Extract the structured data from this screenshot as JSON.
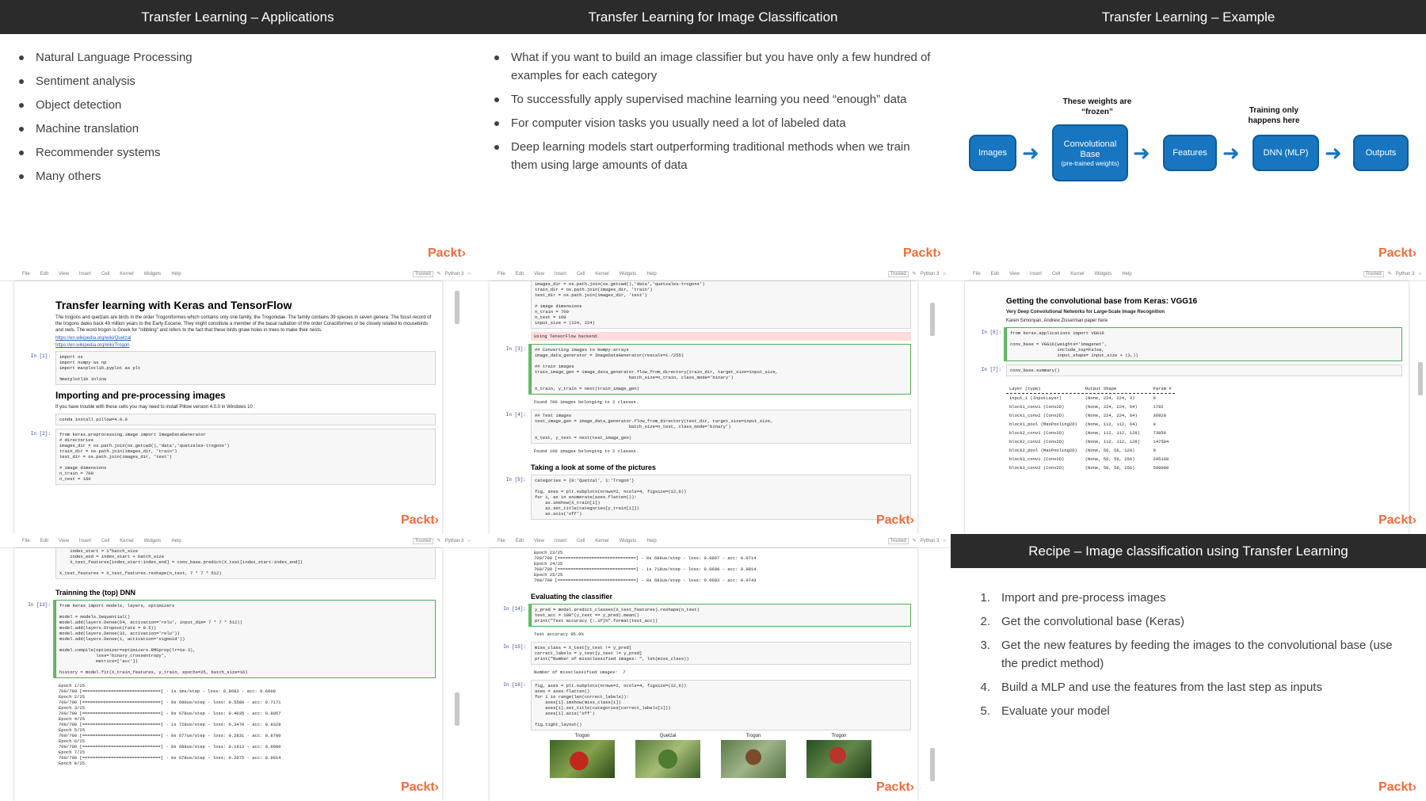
{
  "slides": {
    "applications": {
      "title": "Transfer Learning – Applications",
      "items": [
        "Natural Language Processing",
        "Sentiment analysis",
        "Object detection",
        "Machine translation",
        "Recommender systems",
        "Many others"
      ]
    },
    "image_classification": {
      "title": "Transfer Learning for Image Classification",
      "items": [
        "What if you want to build an image classifier but you have only a few hundred of examples for each category",
        "To successfully apply supervised machine learning you need “enough” data",
        "For computer vision tasks you usually need a lot of labeled data",
        "Deep learning models start outperforming traditional methods when we train them using large amounts of data"
      ]
    },
    "example": {
      "title": "Transfer Learning – Example",
      "note_frozen": "These weights are “frozen”",
      "note_training": "Training only happens here",
      "boxes": {
        "images": "Images",
        "conv": "Convolutional Base",
        "conv_sub": "(pre-trained weights)",
        "features": "Features",
        "dnn": "DNN (MLP)",
        "outputs": "Outputs"
      }
    },
    "recipe": {
      "title": "Recipe – Image classification using Transfer Learning",
      "steps": [
        {
          "num": "1.",
          "text": "Import and pre-process images"
        },
        {
          "num": "2.",
          "text": "Get the convolutional base (Keras)"
        },
        {
          "num": "3.",
          "text": "Get the new features by feeding the images to the convolutional base (use the predict method)"
        },
        {
          "num": "4.",
          "text": "Build a MLP and use the features from the last step as inputs"
        },
        {
          "num": "5.",
          "text": "Evaluate your model"
        }
      ]
    }
  },
  "brand": "Packt›",
  "notebook_menu": {
    "items": [
      "File",
      "Edit",
      "View",
      "Insert",
      "Cell",
      "Kernel",
      "Widgets",
      "Help"
    ],
    "trusted": "Trusted",
    "kernel": "Python 3"
  },
  "nb1": {
    "title": "Transfer learning with Keras and TensorFlow",
    "intro": "The trogons and quetzals are birds in the order Trogoniformes which contains only one family, the Trogonidae. The family contains 39 species in seven genera. The fossil record of the trogons dates back 49 million years to the Early Eocene. They might constitute a member of the basal radiation of the order Coraciiformes or be closely related to mousebirds and owls. The word trogon is Greek for \"nibbling\" and refers to the fact that these birds gnaw holes in trees to make their nests.",
    "link1": "https://en.wikipedia.org/wiki/Quetzal",
    "link2": "https://en.wikipedia.org/wiki/Trogon",
    "p1": "In [1]:",
    "code1": "import os\nimport numpy as np\nimport matplotlib.pyplot as plt\n\n%matplotlib inline",
    "h2": "Importing and pre-processing images",
    "note": "If you have trouble with these cells you may need to install Pillow version 4.0.0 in Windows 10 :",
    "pip": "conda install pillow=4.0.0",
    "p2": "In [2]:",
    "code2": "from keras.preprocessing.image import ImageDataGenerator\n# directories\nimages_dir = os.path.join(os.getcwd(),'data','quetzales-trogons')\ntrain_dir = os.path.join(images_dir, 'train')\ntest_dir = os.path.join(images_dir, 'test')\n\n# image dimensions\nn_train = 700\nn_test = 160"
  },
  "nb2": {
    "code0": "images_dir = os.path.join(os.getcwd(),'data','quetzales-trogons')\ntrain_dir = os.path.join(images_dir, 'train')\ntest_dir = os.path.join(images_dir, 'test')\n\n# image dimensions\nn_train = 700\nn_test = 160\ninput_size = (224, 224)",
    "backend": "Using TensorFlow backend.",
    "p3": "In [3]:",
    "code3": "## Converting images to Numpy-arrays\nimage_data_generator = ImageDataGenerator(rescale=1./255)\n\n## train images\ntrain_image_gen = image_data_generator.flow_from_directory(train_dir, target_size=input_size,\n                                    batch_size=n_train, class_mode='binary')\n\nX_train, y_train = next(train_image_gen)",
    "out3": "Found 700 images belonging to 2 classes.",
    "p4": "In [4]:",
    "code4": "## Test images\ntest_image_gen = image_data_generator.flow_from_directory(test_dir, target_size=input_size,\n                                    batch_size=n_test, class_mode='binary')\n\nX_test, y_test = next(test_image_gen)",
    "out4": "Found 160 images belonging to 2 classes.",
    "h": "Taking a look at some of the pictures",
    "p5": "In [5]:",
    "code5": "categories = {0:'Quetzal', 1:'Trogon'}\n\nfig, axes = plt.subplots(nrows=2, ncols=4, figsize=(12,6))\nfor i, ax in enumerate(axes.flatten()):\n    ax.imshow(X_train[i])\n    ax.set_title(categories[y_train[i]])\n    ax.axis('off')"
  },
  "nb3": {
    "h": "Getting the convolutional base from Keras: VGG16",
    "sub": "Very Deep Convolutional Networks for Large-Scale Image Recognition",
    "authors": "Karen Simonyan, Andrew Zisserman paper here",
    "p6": "In [6]:",
    "code6": "from keras.applications import VGG16\n\nconv_base = VGG16(weights='imagenet',\n                  include_top=False,\n                  input_shape= input_size + (3,))",
    "p7": "In [7]:",
    "code7": "conv_base.summary()",
    "table_header": "Layer (type)                 Output Shape              Param #",
    "rows": [
      "input_1 (InputLayer)         (None, 224, 224, 3)       0",
      "block1_conv1 (Conv2D)        (None, 224, 224, 64)      1792",
      "block1_conv2 (Conv2D)        (None, 224, 224, 64)      36928",
      "block1_pool (MaxPooling2D)   (None, 112, 112, 64)      0",
      "block2_conv1 (Conv2D)        (None, 112, 112, 128)     73856",
      "block2_conv2 (Conv2D)        (None, 112, 112, 128)     147584",
      "block2_pool (MaxPooling2D)   (None, 56, 56, 128)       0",
      "block3_conv1 (Conv2D)        (None, 56, 56, 256)       295168",
      "block3_conv2 (Conv2D)        (None, 56, 56, 256)       590080"
    ]
  },
  "nb4": {
    "code0": "    index_start = i*batch_size\n    index_end = index_start + batch_size\n    X_test_features[index_start:index_end] = conv_base.predict(X_test[index_start:index_end])\n\nX_test_features = X_test_features.reshape(n_test, 7 * 7 * 512)",
    "h": "Trainning the (top) DNN",
    "p13": "In [13]:",
    "code13": "from keras import models, layers, optimizers\n\nmodel = models.Sequential()\nmodel.add(layers.Dense(64, activation='relu', input_dim= 7 * 7 * 512))\nmodel.add(layers.Dropout(rate = 0.5))\nmodel.add(layers.Dense(32, activation='relu'))\nmodel.add(layers.Dense(1, activation='sigmoid'))\n\nmodel.compile(optimizer=optimizers.RMSprop(lr=1e-3),\n              loss='binary_crossentropy',\n              metrics=['acc'])\n\nhistory = model.fit(X_train_features, y_train, epochs=25, batch_size=16)",
    "out": "Epoch 1/25\n700/700 [==============================] - 1s 1ms/step - loss: 0.8683 - acc: 0.6000\nEpoch 2/25\n700/700 [==============================] - 0s 690us/step - loss: 0.5586 - acc: 0.7171\nEpoch 3/25\n700/700 [==============================] - 0s 678us/step - loss: 0.4035 - acc: 0.8057\nEpoch 4/25\n700/700 [==============================] - 1s 728us/step - loss: 0.3470 - acc: 0.8329\nEpoch 5/25\n700/700 [==============================] - 0s 677us/step - loss: 0.2831 - acc: 0.8700\nEpoch 6/25\n700/700 [==============================] - 0s 688us/step - loss: 0.1613 - acc: 0.9000\nEpoch 7/25\n700/700 [==============================] - 0s 678us/step - loss: 0.2075 - acc: 0.9014\nEpoch 8/25"
  },
  "nb5": {
    "out0": "Epoch 23/25\n700/700 [==============================] - 0s 689us/step - loss: 0.0807 - acc: 0.9714\nEpoch 24/25\n700/700 [==============================] - 1s 718us/step - loss: 0.0600 - acc: 0.9814\nEpoch 25/25\n700/700 [==============================] - 0s 683us/step - loss: 0.0603 - acc: 0.9743",
    "h": "Evaluating the classifier",
    "p14": "In [14]:",
    "code14": "y_pred = model.predict_classes(X_test_features).reshape(n_test)\ntest_acc = 100*(y_test == y_pred).mean()\nprint(\"Test accuracy {:.1f}%\".format(test_acc))",
    "out14": "Test accuracy 95.0%",
    "p15": "In [15]:",
    "code15": "miss_class = X_test[y_test != y_pred]\ncorrect_labels = y_test[y_test != y_pred]\nprint(\"Number of missclassified images: \", len(miss_class))",
    "out15": "Number of missclassified images:  7",
    "p16": "In [16]:",
    "code16": "fig, axes = plt.subplots(nrows=2, ncols=4, figsize=(12,6))\naxes = axes.flatten()\nfor i in range(len(correct_labels)):\n    axes[i].imshow(miss_class[i])\n    axes[i].set_title(categories[correct_labels[i]])\n    axes[i].axis('off')\n\nfig.tight_layout()",
    "labels": [
      "Trogon",
      "Quetzal",
      "Trogon",
      "Trogon"
    ]
  }
}
